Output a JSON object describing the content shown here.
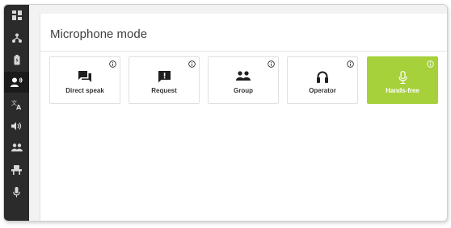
{
  "panel": {
    "title": "Microphone mode"
  },
  "sidebar": {
    "items": [
      {
        "icon": "dashboard-icon"
      },
      {
        "icon": "network-icon"
      },
      {
        "icon": "battery-icon"
      },
      {
        "icon": "speaker-user-icon",
        "active": true
      },
      {
        "icon": "translate-icon"
      },
      {
        "icon": "volume-icon"
      },
      {
        "icon": "group-icon"
      },
      {
        "icon": "seat-icon"
      },
      {
        "icon": "microphone-icon"
      }
    ]
  },
  "modes": [
    {
      "label": "Direct speak",
      "icon": "chat-bubbles-icon",
      "selected": false
    },
    {
      "label": "Request",
      "icon": "request-icon",
      "selected": false
    },
    {
      "label": "Group",
      "icon": "group-icon",
      "selected": false
    },
    {
      "label": "Operator",
      "icon": "headset-icon",
      "selected": false
    },
    {
      "label": "Hands-free",
      "icon": "microphone-icon",
      "selected": true
    }
  ],
  "colors": {
    "accent": "#a6d13a",
    "sidebar": "#2b2b2b"
  }
}
